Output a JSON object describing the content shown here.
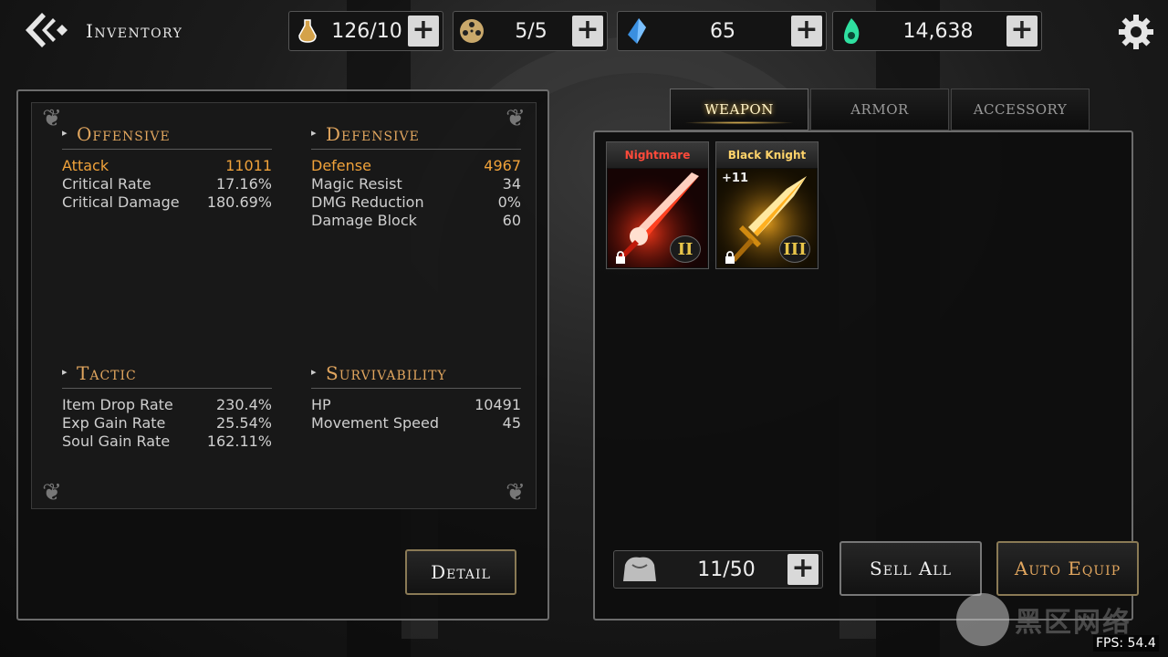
{
  "header": {
    "title": "Inventory",
    "resources": [
      {
        "icon": "stamina-potion-icon",
        "value": "126/10",
        "color": "#d4a24a"
      },
      {
        "icon": "film-reel-icon",
        "value": "5/5",
        "color": "#c9a86b"
      },
      {
        "icon": "blue-crystal-icon",
        "value": "65",
        "color": "#3a8fe0"
      },
      {
        "icon": "green-soul-icon",
        "value": "14,638",
        "color": "#2fe0a0"
      }
    ],
    "plus_label": "+"
  },
  "stats": {
    "offensive": {
      "title": "Offensive",
      "rows": [
        {
          "label": "Attack",
          "value": "11011"
        },
        {
          "label": "Critical Rate",
          "value": "17.16%"
        },
        {
          "label": "Critical Damage",
          "value": "180.69%"
        }
      ]
    },
    "defensive": {
      "title": "Defensive",
      "rows": [
        {
          "label": "Defense",
          "value": "4967"
        },
        {
          "label": "Magic Resist",
          "value": "34"
        },
        {
          "label": "DMG Reduction",
          "value": "0%"
        },
        {
          "label": "Damage Block",
          "value": "60"
        }
      ]
    },
    "tactic": {
      "title": "Tactic",
      "rows": [
        {
          "label": "Item Drop Rate",
          "value": "230.4%"
        },
        {
          "label": "Exp Gain Rate",
          "value": "25.54%"
        },
        {
          "label": "Soul Gain Rate",
          "value": "162.11%"
        }
      ]
    },
    "survivability": {
      "title": "Survivability",
      "rows": [
        {
          "label": "HP",
          "value": "10491"
        },
        {
          "label": "Movement Speed",
          "value": "45"
        }
      ]
    },
    "detail_label": "Detail"
  },
  "tabs": [
    "WEAPON",
    "ARMOR",
    "ACCESSORY"
  ],
  "items": [
    {
      "name": "Nightmare",
      "name_color": "#ff4a3a",
      "level": "",
      "tier": "II",
      "glow": "#ff2a1a"
    },
    {
      "name": "Black Knight",
      "name_color": "#ffd36a",
      "level": "+11",
      "tier": "III",
      "glow": "#ffb020"
    }
  ],
  "bag": {
    "value": "11/50",
    "plus_label": "+"
  },
  "actions": {
    "sell_all": "Sell All",
    "auto_equip": "Auto Equip",
    "auto_equip_color": "#e0a55e"
  },
  "watermark": "黑区网络",
  "fps": "FPS: 54.4"
}
